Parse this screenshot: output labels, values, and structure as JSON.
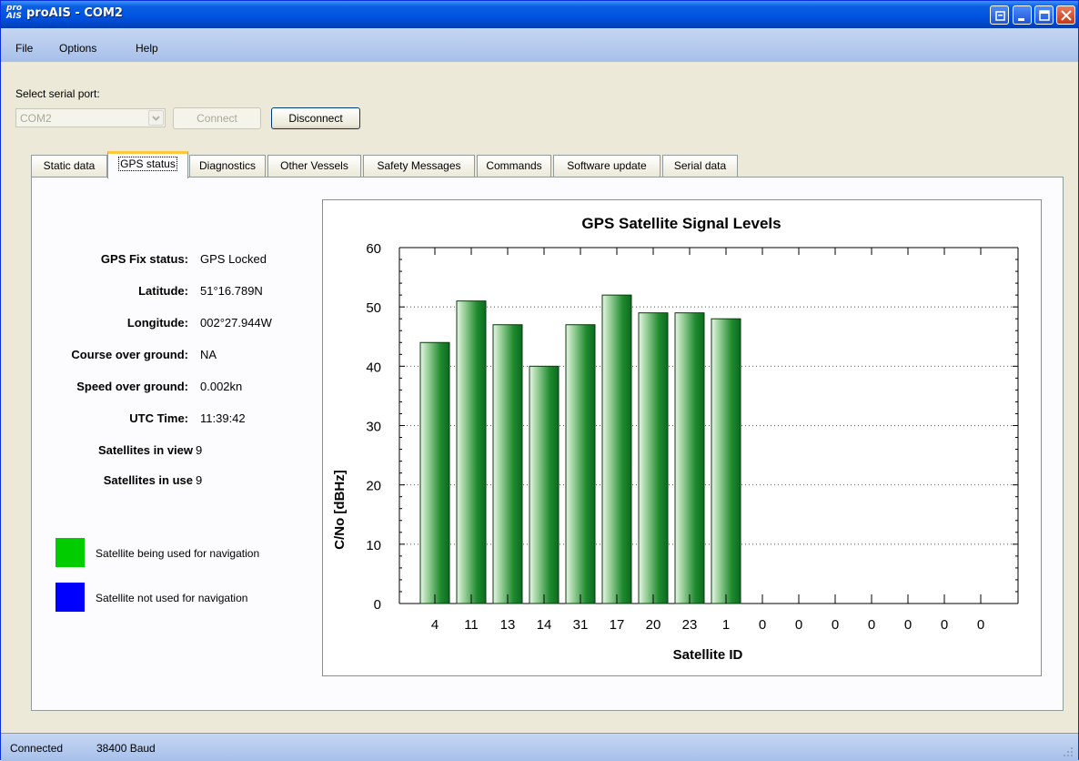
{
  "window": {
    "app_icon_text": "pro AIS",
    "title": "proAIS - COM2"
  },
  "menu": [
    "File",
    "Options",
    "Help"
  ],
  "serial": {
    "label": "Select serial port:",
    "port_value": "COM2",
    "connect_label": "Connect",
    "disconnect_label": "Disconnect"
  },
  "tabs": [
    "Static data",
    "GPS status",
    "Diagnostics",
    "Other Vessels",
    "Safety Messages",
    "Commands",
    "Software update",
    "Serial data"
  ],
  "active_tab": "GPS status",
  "gps": {
    "rows": [
      {
        "label": "GPS Fix status:",
        "value": "GPS Locked"
      },
      {
        "label": "Latitude:",
        "value": "51°16.789N"
      },
      {
        "label": "Longitude:",
        "value": "002°27.944W"
      },
      {
        "label": "Course over ground:",
        "value": "NA"
      },
      {
        "label": "Speed over ground:",
        "value": "0.002kn"
      },
      {
        "label": "UTC Time:",
        "value": "11:39:42"
      },
      {
        "label": "Satellites in view",
        "value": "9"
      },
      {
        "label": "Satellites in use",
        "value": "9"
      }
    ],
    "legend": [
      {
        "label": "Satellite being used for navigation",
        "color": "#00cc00"
      },
      {
        "label": "Satellite not used for navigation",
        "color": "#0000ff"
      }
    ]
  },
  "chart_data": {
    "type": "bar",
    "title": "GPS Satellite Signal Levels",
    "xlabel": "Satellite ID",
    "ylabel": "C/No [dBHz]",
    "ylim": [
      0,
      60
    ],
    "yticks": [
      "0",
      "10",
      "20",
      "30",
      "40",
      "50",
      "60"
    ],
    "categories": [
      "4",
      "11",
      "13",
      "14",
      "31",
      "17",
      "20",
      "23",
      "1",
      "0",
      "0",
      "0",
      "0",
      "0",
      "0",
      "0"
    ],
    "values": [
      44,
      51,
      47,
      40,
      47,
      52,
      49,
      49,
      48,
      0,
      0,
      0,
      0,
      0,
      0,
      0
    ],
    "grid": "horizontal dotted",
    "bar_color": "#0a7a2a"
  },
  "status": {
    "connection": "Connected",
    "baud": "38400 Baud"
  }
}
